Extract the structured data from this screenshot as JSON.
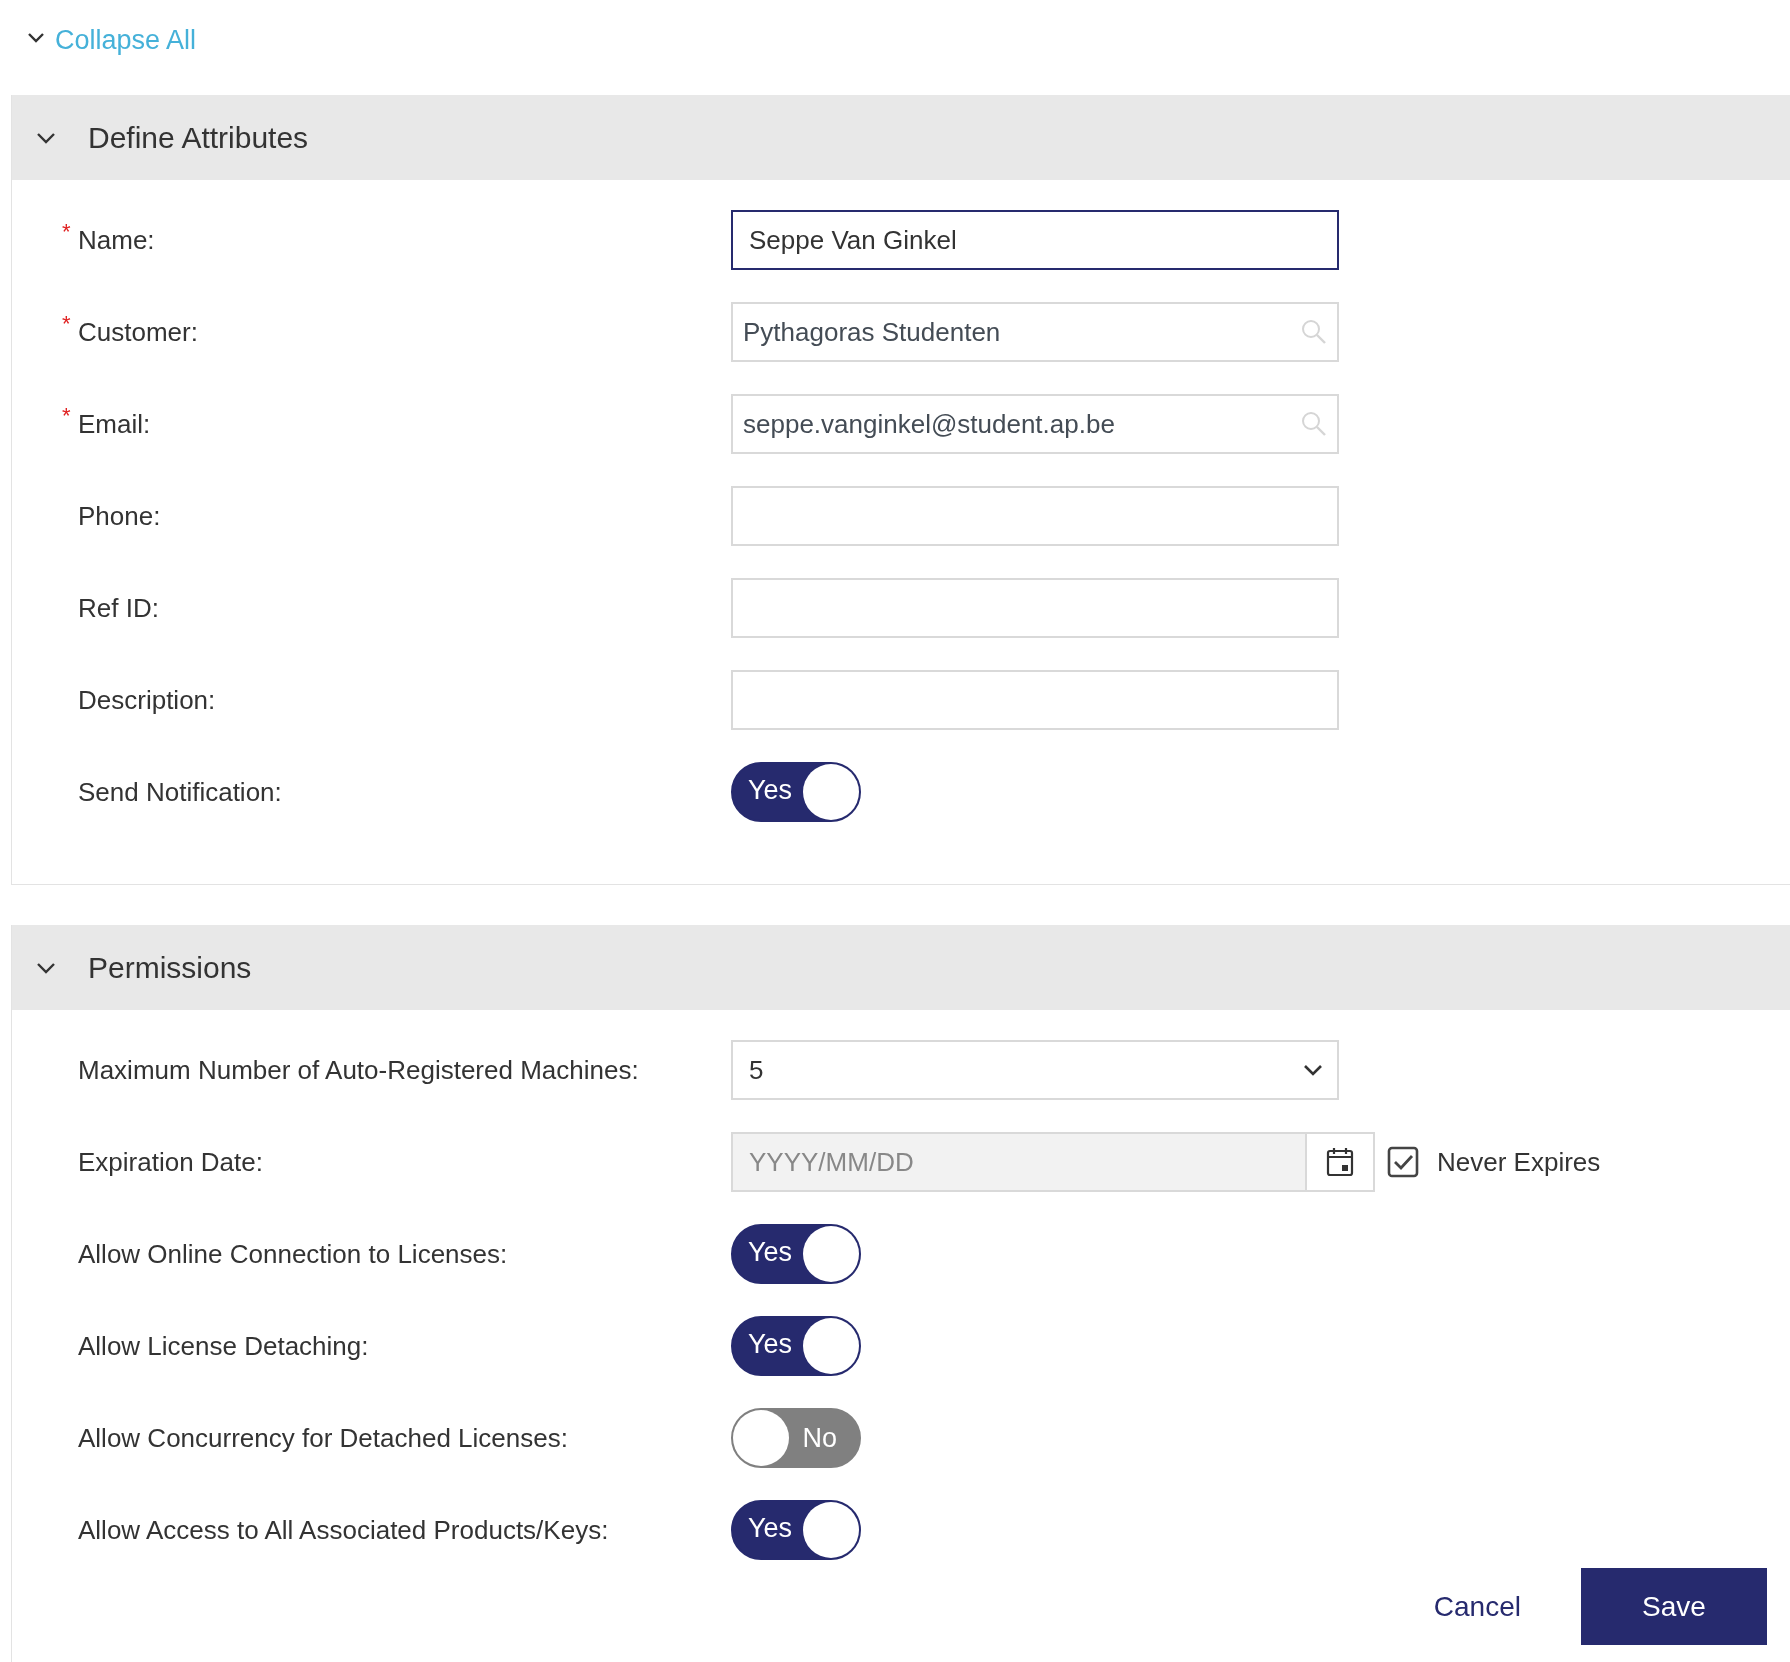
{
  "collapse_all": {
    "label": "Collapse All"
  },
  "sections": [
    {
      "title": "Define Attributes",
      "expanded": true,
      "fields": [
        {
          "kind": "text",
          "label": "Name:",
          "required_mark": "*",
          "value": "Seppe Van Ginkel",
          "focused": true
        },
        {
          "kind": "search",
          "label": "Customer:",
          "required_mark": "*",
          "value": "Pythagoras Studenten",
          "focused": false
        },
        {
          "kind": "search",
          "label": "Email:",
          "required_mark": "*",
          "value": "seppe.vanginkel@student.ap.be",
          "focused": false
        },
        {
          "kind": "text",
          "label": "Phone:",
          "focused": false
        },
        {
          "kind": "text",
          "label": "Ref ID:",
          "focused": false
        },
        {
          "kind": "text",
          "label": "Description:",
          "focused": false
        },
        {
          "kind": "toggle",
          "label": "Send Notification:",
          "on": true,
          "text": "Yes"
        }
      ]
    },
    {
      "title": "Permissions",
      "expanded": true,
      "fields": [
        {
          "kind": "select",
          "label": "Maximum Number of Auto-Registered Machines:",
          "value": "5"
        },
        {
          "kind": "date",
          "label": "Expiration Date:",
          "placeholder": "YYYY/MM/DD",
          "disabled": true,
          "checkbox": {
            "label": "Never Expires",
            "checked": true
          }
        },
        {
          "kind": "toggle",
          "label": "Allow Online Connection to Licenses:",
          "on": true,
          "text": "Yes"
        },
        {
          "kind": "toggle",
          "label": "Allow License Detaching:",
          "on": true,
          "text": "Yes"
        },
        {
          "kind": "toggle",
          "label": "Allow Concurrency for Detached Licenses:",
          "on": false,
          "text": "No"
        },
        {
          "kind": "toggle",
          "label": "Allow Access to All Associated Products/Keys:",
          "on": true,
          "text": "Yes"
        }
      ]
    }
  ],
  "buttons": {
    "cancel": "Cancel",
    "save": "Save"
  }
}
